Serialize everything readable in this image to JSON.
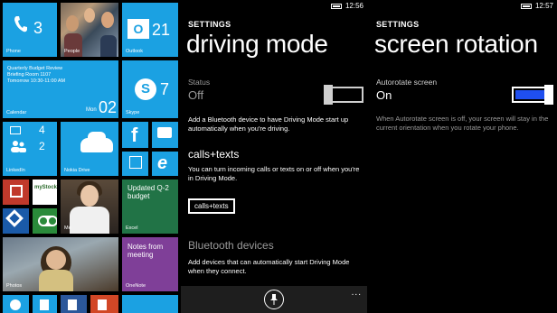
{
  "start": {
    "phone": {
      "count": "3",
      "label": "Phone"
    },
    "people": {
      "label": "People"
    },
    "outlook": {
      "count": "21",
      "label": "Outlook"
    },
    "calendar": {
      "line1": "Quarterly Budget Review",
      "line2": "Briefing Room 1107",
      "line3": "Tomorrow 10:30-11:00 AM",
      "day": "Mon",
      "date": "02",
      "label": "Calendar"
    },
    "skype": {
      "letter": "S",
      "count": "7",
      "label": "Skype"
    },
    "linkedin": {
      "count_top": "4",
      "count_bottom": "2",
      "label": "LinkedIn"
    },
    "nokia_drive": {
      "label": "Nokia Drive"
    },
    "facebook": {
      "letter": "f"
    },
    "ie": {
      "letter": "e"
    },
    "me": {
      "label": "Me"
    },
    "excel": {
      "text": "Updated Q-2 budget",
      "label": "Excel"
    },
    "mystocks": {
      "text": "myStocks"
    },
    "onenote": {
      "text": "Notes from meeting",
      "label": "OneNote"
    },
    "photos": {
      "label": "Photos"
    }
  },
  "driving": {
    "time": "12:56",
    "crumb": "SETTINGS",
    "title": "driving mode",
    "status_label": "Status",
    "status_value": "Off",
    "toggle_value": 0,
    "desc1": "Add a Bluetooth device to have Driving Mode start up automatically when you're driving.",
    "section_calls": "calls+texts",
    "desc2": "You can turn incoming calls or texts on or off when you're in Driving Mode.",
    "calls_button": "calls+texts",
    "section_bt": "Bluetooth devices",
    "desc3": "Add devices that can automatically start Driving Mode when they connect.",
    "more": "..."
  },
  "rotation": {
    "time": "12:57",
    "crumb": "SETTINGS",
    "title": "screen rotation",
    "setting_label": "Autorotate screen",
    "setting_value": "On",
    "toggle_value": 1,
    "desc": "When Autorotate screen is off, your screen will stay in the current orientation when you rotate your phone."
  },
  "colors": {
    "accent": "#1ba1e2",
    "toggle_on": "#1f4ff0",
    "excel": "#217346",
    "onenote": "#7f3f98",
    "red": "#c0392b"
  }
}
